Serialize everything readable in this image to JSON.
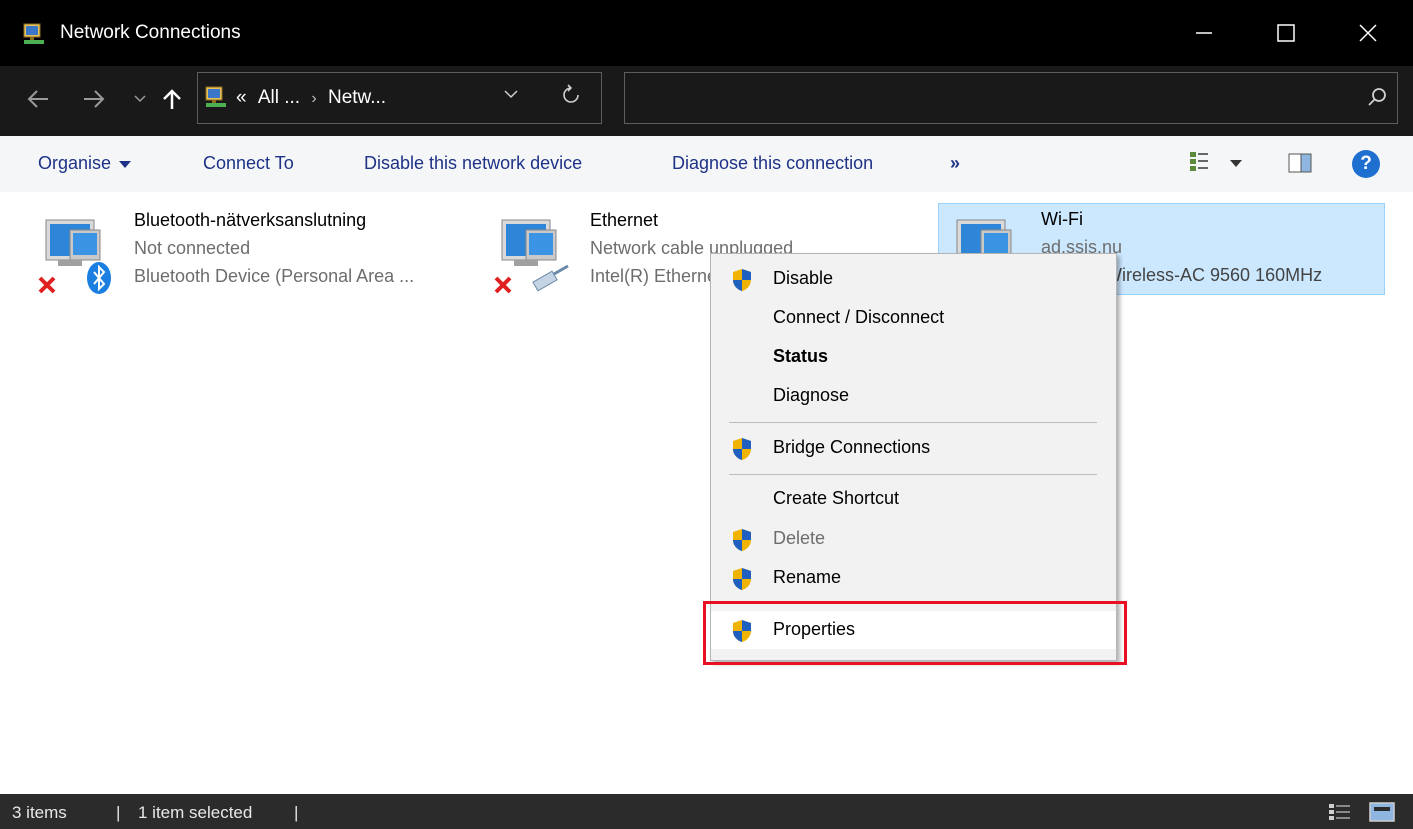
{
  "window": {
    "title": "Network Connections",
    "controls": {
      "minimize": "minimize",
      "maximize": "maximize",
      "close": "close"
    }
  },
  "nav": {
    "back_icon": "back-arrow-icon",
    "forward_icon": "forward-arrow-icon",
    "recent_icon": "recent-chevron-icon",
    "up_icon": "up-arrow-icon",
    "breadcrumb": {
      "prefix": "«",
      "items": [
        "All ...",
        "Netw..."
      ],
      "separator": "›"
    },
    "search_placeholder": ""
  },
  "commands": {
    "organise": "Organise",
    "connect_to": "Connect To",
    "disable": "Disable this network device",
    "diagnose": "Diagnose this connection",
    "more": "»"
  },
  "connections": [
    {
      "name": "Bluetooth-nätverksanslutning",
      "status": "Not connected",
      "device": "Bluetooth Device (Personal Area ..."
    },
    {
      "name": "Ethernet",
      "status": "Network cable unplugged",
      "device": "Intel(R) Ethernet Connection"
    },
    {
      "name": "Wi-Fi",
      "status": "ad.ssis.nu",
      "device": "Intel(R) Wireless-AC 9560 160MHz",
      "selected": true
    }
  ],
  "context_menu": {
    "items": [
      {
        "label": "Disable",
        "shield": true
      },
      {
        "label": "Connect / Disconnect",
        "shield": false
      },
      {
        "label": "Status",
        "shield": false,
        "bold": true
      },
      {
        "label": "Diagnose",
        "shield": false
      },
      {
        "label": "Bridge Connections",
        "shield": true
      },
      {
        "label": "Create Shortcut",
        "shield": false
      },
      {
        "label": "Delete",
        "shield": true,
        "disabled": true
      },
      {
        "label": "Rename",
        "shield": true
      },
      {
        "label": "Properties",
        "shield": true,
        "highlighted": true
      }
    ]
  },
  "statusbar": {
    "items_count": "3 items",
    "selected": "1 item selected"
  },
  "colors": {
    "accent_selection": "#cce8ff",
    "highlight_border": "#e81123",
    "command_text": "#1e3287"
  }
}
